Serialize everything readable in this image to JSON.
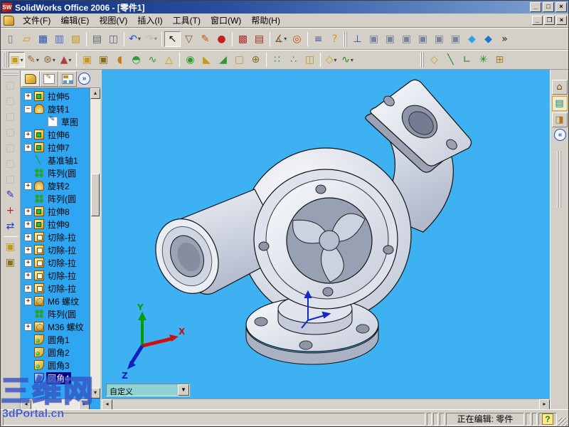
{
  "window": {
    "app_icon": "SW",
    "title": "SolidWorks Office 2006 - [零件1]",
    "controls": {
      "minimize": "_",
      "maximize": "□",
      "close": "×"
    },
    "doc_controls": {
      "minimize": "_",
      "restore": "❒",
      "close": "×"
    }
  },
  "menu": {
    "items": [
      "文件(F)",
      "编辑(E)",
      "视图(V)",
      "插入(I)",
      "工具(T)",
      "窗口(W)",
      "帮助(H)"
    ]
  },
  "toolbars": {
    "standard": [
      {
        "name": "new",
        "glyph": "▯",
        "color": "#6b7b94"
      },
      {
        "name": "open",
        "glyph": "▱",
        "color": "#d89010"
      },
      {
        "name": "save",
        "glyph": "▦",
        "color": "#2850b8"
      },
      {
        "name": "make-drawing-from-part",
        "glyph": "▥",
        "color": "#4868c0"
      },
      {
        "name": "make-assembly-from-part",
        "glyph": "▧",
        "color": "#c89818"
      },
      {
        "sep": true
      },
      {
        "name": "print",
        "glyph": "▤",
        "color": "#5a6372"
      },
      {
        "name": "print-preview",
        "glyph": "◫",
        "color": "#5a6372"
      },
      {
        "sep": true
      },
      {
        "name": "undo",
        "glyph": "↶",
        "color": "#1e4fd0",
        "dropdown": true
      },
      {
        "name": "redo",
        "glyph": "↷",
        "color": "#a8a8a8",
        "dropdown": true,
        "disabled": true
      },
      {
        "sep": true
      },
      {
        "name": "select",
        "glyph": "↖",
        "color": "#111111",
        "pressed": true
      },
      {
        "name": "selection-filter",
        "glyph": "▽",
        "color": "#7d5a28"
      },
      {
        "name": "edit-color",
        "glyph": "✎",
        "color": "#c05818"
      },
      {
        "name": "lights",
        "glyph": "●",
        "color": "#c42020"
      },
      {
        "sep": true
      },
      {
        "name": "color-palette",
        "glyph": "▩",
        "color": "#b03030"
      },
      {
        "name": "texture",
        "glyph": "▤",
        "color": "#a03018"
      },
      {
        "sep": true
      },
      {
        "name": "measure",
        "glyph": "∡",
        "color": "#7d5a28",
        "dropdown": true
      },
      {
        "name": "check-entity",
        "glyph": "◎",
        "color": "#c05010"
      },
      {
        "sep": true
      },
      {
        "name": "options",
        "glyph": "≡",
        "color": "#3c5aa0"
      },
      {
        "name": "help",
        "glyph": "?",
        "color": "#d89010"
      },
      {
        "grip": true
      },
      {
        "name": "normal-to",
        "glyph": "⊥",
        "color": "#2850b8"
      },
      {
        "name": "front-view",
        "glyph": "▣",
        "color": "#76829a"
      },
      {
        "name": "back-view",
        "glyph": "▣",
        "color": "#76829a"
      },
      {
        "name": "left-view",
        "glyph": "▣",
        "color": "#76829a"
      },
      {
        "name": "right-view",
        "glyph": "▣",
        "color": "#76829a"
      },
      {
        "name": "top-view",
        "glyph": "▣",
        "color": "#76829a"
      },
      {
        "name": "bottom-view",
        "glyph": "▣",
        "color": "#76829a"
      },
      {
        "name": "isometric-view",
        "glyph": "◆",
        "color": "#2fa3ea"
      },
      {
        "name": "trimetric-view",
        "glyph": "◆",
        "color": "#1777cc"
      },
      {
        "name": "toolbar-overflow",
        "glyph": "»",
        "color": "#202020"
      }
    ],
    "features": [
      {
        "grip": true
      },
      {
        "name": "features-flyout",
        "glyph": "▣",
        "color": "#c89818",
        "dropdown": true,
        "pressed": true
      },
      {
        "name": "sketch-flyout",
        "glyph": "✎",
        "color": "#b06820",
        "dropdown": true
      },
      {
        "name": "hole-wizard-flyout",
        "glyph": "⊛",
        "color": "#8a6a20",
        "dropdown": true
      },
      {
        "name": "selection-tools-flyout",
        "glyph": "▲",
        "color": "#b04040",
        "dropdown": true
      },
      {
        "sep": true
      },
      {
        "name": "extruded-boss",
        "glyph": "▣",
        "color": "#c89818"
      },
      {
        "name": "extruded-cut",
        "glyph": "▣",
        "color": "#8a7018"
      },
      {
        "name": "revolved-boss",
        "glyph": "◖",
        "color": "#c87818"
      },
      {
        "name": "revolved-cut",
        "glyph": "◓",
        "color": "#2f9a2f"
      },
      {
        "name": "swept-boss",
        "glyph": "∿",
        "color": "#2f9a2f"
      },
      {
        "name": "lofted-boss",
        "glyph": "△",
        "color": "#c89818"
      },
      {
        "sep": true
      },
      {
        "name": "fillet",
        "glyph": "◉",
        "color": "#2f9a2f"
      },
      {
        "name": "chamfer",
        "glyph": "◣",
        "color": "#c89818"
      },
      {
        "name": "rib",
        "glyph": "◢",
        "color": "#2f9a2f"
      },
      {
        "name": "shell",
        "glyph": "▢",
        "color": "#c89818"
      },
      {
        "name": "hole-wizard",
        "glyph": "⊕",
        "color": "#8a6a20"
      },
      {
        "sep": true
      },
      {
        "name": "linear-pattern",
        "glyph": "∷",
        "color": "#2f9a2f"
      },
      {
        "name": "circular-pattern",
        "glyph": "∴",
        "color": "#2f9a2f"
      },
      {
        "name": "mirror",
        "glyph": "◫",
        "color": "#c89818"
      },
      {
        "sep": true
      },
      {
        "name": "reference-plane",
        "glyph": "◇",
        "color": "#c8a018",
        "dropdown": true
      },
      {
        "name": "curve",
        "glyph": "∿",
        "color": "#1a8a1a",
        "dropdown": true
      },
      {
        "spacer": true
      },
      {
        "grip": true
      },
      {
        "name": "plane",
        "glyph": "◇",
        "color": "#c8a018"
      },
      {
        "name": "axis",
        "glyph": "╲",
        "color": "#1a8a1a"
      },
      {
        "name": "coordinate-system",
        "glyph": "∟",
        "color": "#1a8a1a"
      },
      {
        "name": "point",
        "glyph": "✳",
        "color": "#1a8a1a"
      },
      {
        "name": "mate-reference",
        "glyph": "⊞",
        "color": "#b08020"
      }
    ]
  },
  "left_toolbar": [
    {
      "grip": true
    },
    {
      "name": "view-orientation-1",
      "glyph": "▢",
      "color": "#9aa0a8",
      "disabled": true
    },
    {
      "name": "view-orientation-2",
      "glyph": "▢",
      "color": "#9aa0a8",
      "disabled": true
    },
    {
      "name": "view-orientation-3",
      "glyph": "▢",
      "color": "#9aa0a8",
      "disabled": true
    },
    {
      "name": "view-orientation-4",
      "glyph": "▢",
      "color": "#9aa0a8",
      "disabled": true
    },
    {
      "name": "view-orientation-5",
      "glyph": "▢",
      "color": "#9aa0a8",
      "disabled": true
    },
    {
      "name": "view-orientation-6",
      "glyph": "▢",
      "color": "#9aa0a8",
      "disabled": true
    },
    {
      "name": "view-orientation-7",
      "glyph": "▢",
      "color": "#9aa0a8",
      "disabled": true
    },
    {
      "name": "sketch",
      "glyph": "✎",
      "color": "#2040c0"
    },
    {
      "name": "3d-sketch",
      "glyph": "+",
      "color": "#c02020"
    },
    {
      "name": "move-copy",
      "glyph": "⇄",
      "color": "#2040c0"
    },
    {
      "sep": true
    },
    {
      "name": "extruded-boss-side",
      "glyph": "▣",
      "color": "#c89818"
    },
    {
      "name": "extruded-cut-side",
      "glyph": "▣",
      "color": "#8a7018"
    }
  ],
  "tree": {
    "tabs": [
      {
        "name": "feature-manager-tab",
        "icon": "feature-manager-icon",
        "active": true
      },
      {
        "name": "property-manager-tab",
        "icon": "property-manager-icon"
      },
      {
        "name": "configuration-manager-tab",
        "icon": "configuration-manager-icon"
      }
    ],
    "chevron": "»",
    "items": [
      {
        "label": "拉伸5",
        "icon": "extrude",
        "exp": "+"
      },
      {
        "label": "旋转1",
        "icon": "revolve",
        "exp": "-"
      },
      {
        "label": "草图",
        "icon": "sketch",
        "child": true
      },
      {
        "label": "拉伸6",
        "icon": "extrude",
        "exp": "+"
      },
      {
        "label": "拉伸7",
        "icon": "extrude",
        "exp": "+"
      },
      {
        "label": "基准轴1",
        "icon": "axis"
      },
      {
        "label": "阵列(圆",
        "icon": "pattern"
      },
      {
        "label": "旋转2",
        "icon": "revolve",
        "exp": "+"
      },
      {
        "label": "阵列(圆",
        "icon": "pattern"
      },
      {
        "label": "拉伸8",
        "icon": "extrude",
        "exp": "+"
      },
      {
        "label": "拉伸9",
        "icon": "extrude",
        "exp": "+"
      },
      {
        "label": "切除-拉",
        "icon": "cut",
        "exp": "+"
      },
      {
        "label": "切除-拉",
        "icon": "cut",
        "exp": "+"
      },
      {
        "label": "切除-拉",
        "icon": "cut",
        "exp": "+"
      },
      {
        "label": "切除-拉",
        "icon": "cut",
        "exp": "+"
      },
      {
        "label": "切除-拉",
        "icon": "cut",
        "exp": "+"
      },
      {
        "label": "M6 螺纹",
        "icon": "thread",
        "exp": "+"
      },
      {
        "label": "阵列(圆",
        "icon": "pattern"
      },
      {
        "label": "M36 螺纹",
        "icon": "thread",
        "exp": "+"
      },
      {
        "label": "圆角1",
        "icon": "fillet"
      },
      {
        "label": "圆角2",
        "icon": "fillet"
      },
      {
        "label": "圆角3",
        "icon": "fillet"
      },
      {
        "label": "圆角4",
        "icon": "fillet-blue",
        "selected": true
      }
    ]
  },
  "viewport": {
    "background": "#3eb1f2",
    "combo": {
      "value": "自定义"
    },
    "triad": {
      "x": "X",
      "y": "Y",
      "z": "Z"
    }
  },
  "task_pane": {
    "tabs": [
      {
        "name": "home-tab",
        "glyph": "⌂",
        "color": "#7a4a10"
      },
      {
        "name": "solidworks-resources-tab",
        "glyph": "▤",
        "color": "#1f8a3f",
        "active": true
      },
      {
        "name": "design-library-tab",
        "glyph": "◨",
        "color": "#b07818"
      }
    ],
    "collapse": "«"
  },
  "status_bar": {
    "editing": "正在编辑: 零件",
    "help_icon": "?"
  },
  "watermark": {
    "title": "三维网",
    "url": "3dPortal.cn"
  }
}
